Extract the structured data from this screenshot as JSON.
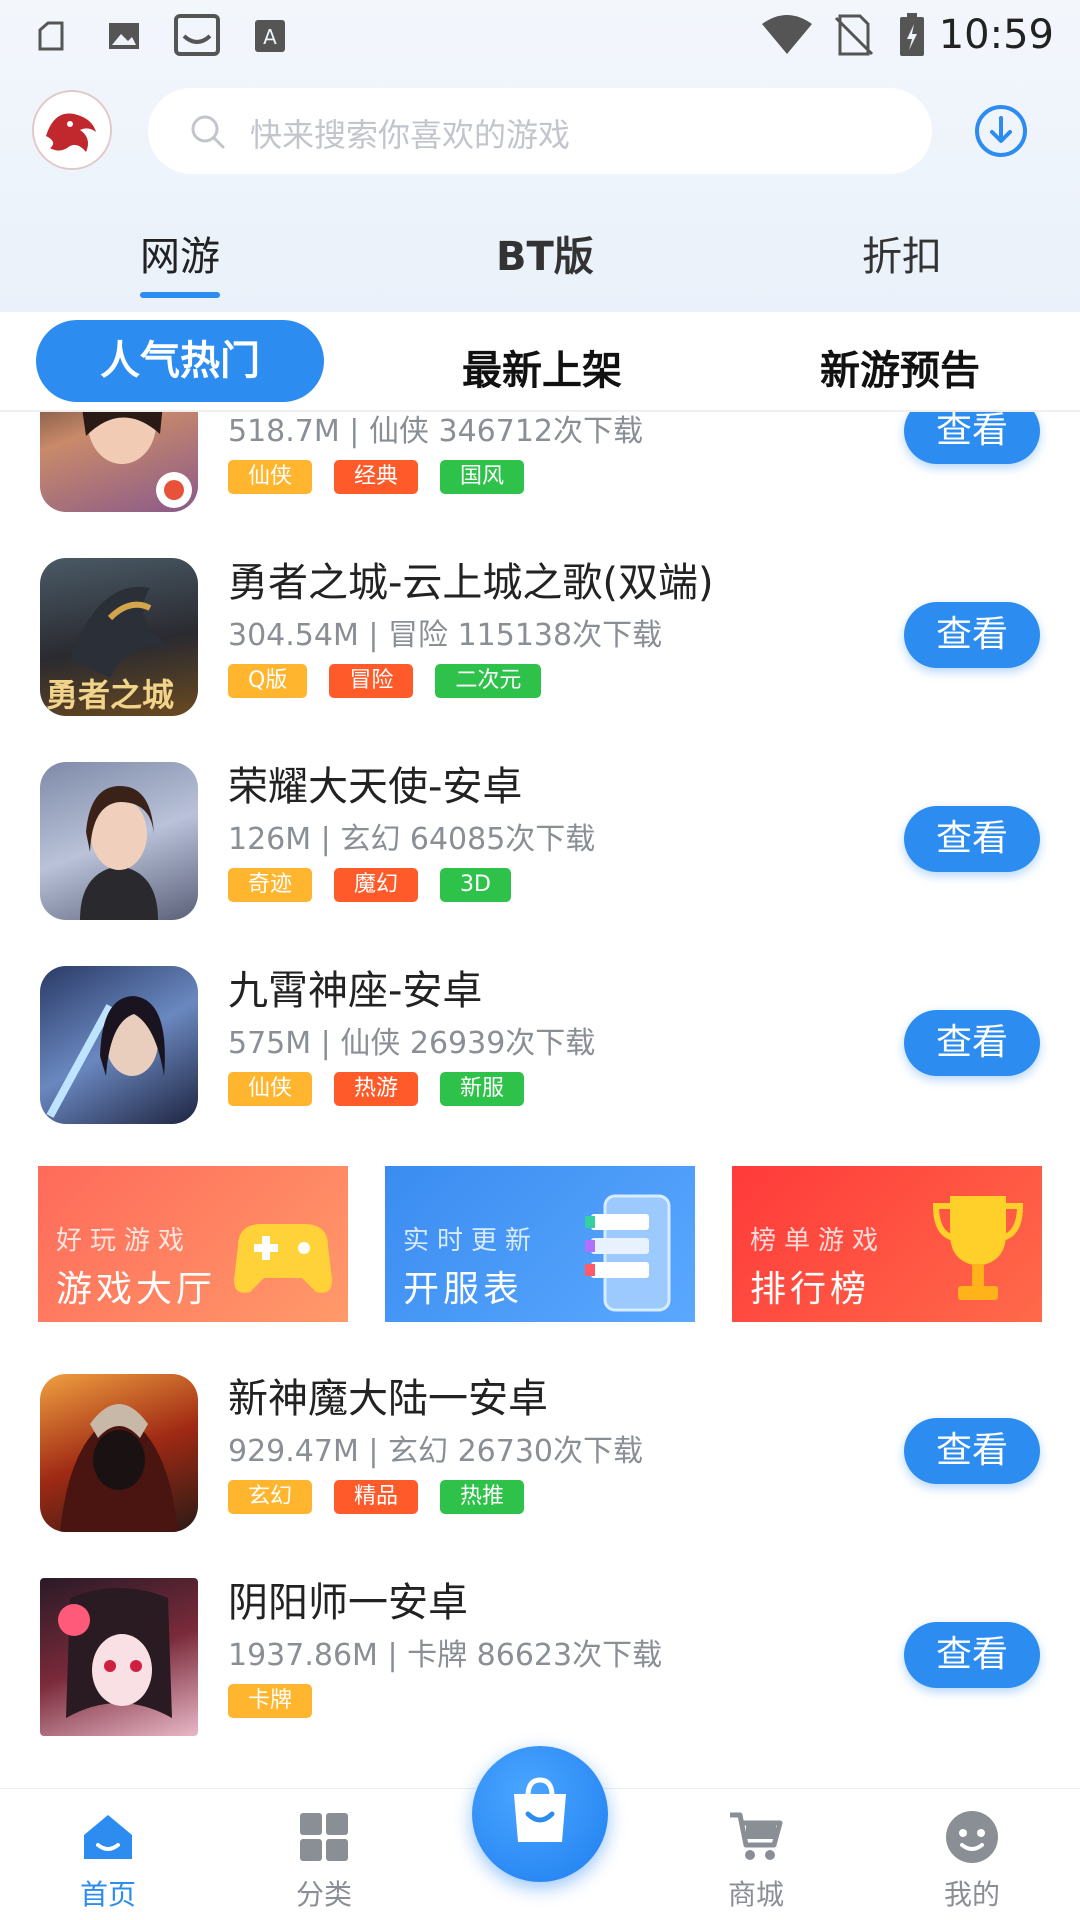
{
  "status_bar": {
    "time": "10:59"
  },
  "search": {
    "placeholder": "快来搜索你喜欢的游戏"
  },
  "tabs": [
    {
      "label": "网游"
    },
    {
      "label": "BT版"
    },
    {
      "label": "折扣"
    }
  ],
  "subtabs": [
    {
      "label": "人气热门"
    },
    {
      "label": "最新上架"
    },
    {
      "label": "新游预告"
    }
  ],
  "games": [
    {
      "name": "",
      "meta": "518.7M | 仙侠  346712次下载",
      "tags": [
        "仙侠",
        "经典",
        "国风"
      ],
      "button": "查看"
    },
    {
      "name": "勇者之城-云上城之歌(双端)",
      "meta": "304.54M | 冒险  115138次下载",
      "tags": [
        "Q版",
        "冒险",
        "二次元"
      ],
      "button": "查看"
    },
    {
      "name": "荣耀大天使-安卓",
      "meta": "126M | 玄幻  64085次下载",
      "tags": [
        "奇迹",
        "魔幻",
        "3D"
      ],
      "button": "查看"
    },
    {
      "name": "九霄神座-安卓",
      "meta": "575M | 仙侠  26939次下载",
      "tags": [
        "仙侠",
        "热游",
        "新服"
      ],
      "button": "查看"
    },
    {
      "name": "新神魔大陆一安卓",
      "meta": "929.47M | 玄幻  26730次下载",
      "tags": [
        "玄幻",
        "精品",
        "热推"
      ],
      "button": "查看"
    },
    {
      "name": "阴阳师一安卓",
      "meta": "1937.86M | 卡牌  86623次下载",
      "tags": [
        "卡牌"
      ],
      "button": "查看"
    }
  ],
  "thumb_text": {
    "game1": "勇者之城"
  },
  "banners": [
    {
      "small": "好玩游戏",
      "big": "游戏大厅"
    },
    {
      "small": "实时更新",
      "big": "开服表"
    },
    {
      "small": "榜单游戏",
      "big": "排行榜"
    }
  ],
  "bottom_nav": [
    {
      "label": "首页"
    },
    {
      "label": "分类"
    },
    {
      "label": "商城"
    },
    {
      "label": "我的"
    }
  ],
  "colors": {
    "accent": "#2d8cf0",
    "tag_orange": "#ffb52e",
    "tag_red": "#ff5a2a",
    "tag_green": "#2fc24a"
  }
}
